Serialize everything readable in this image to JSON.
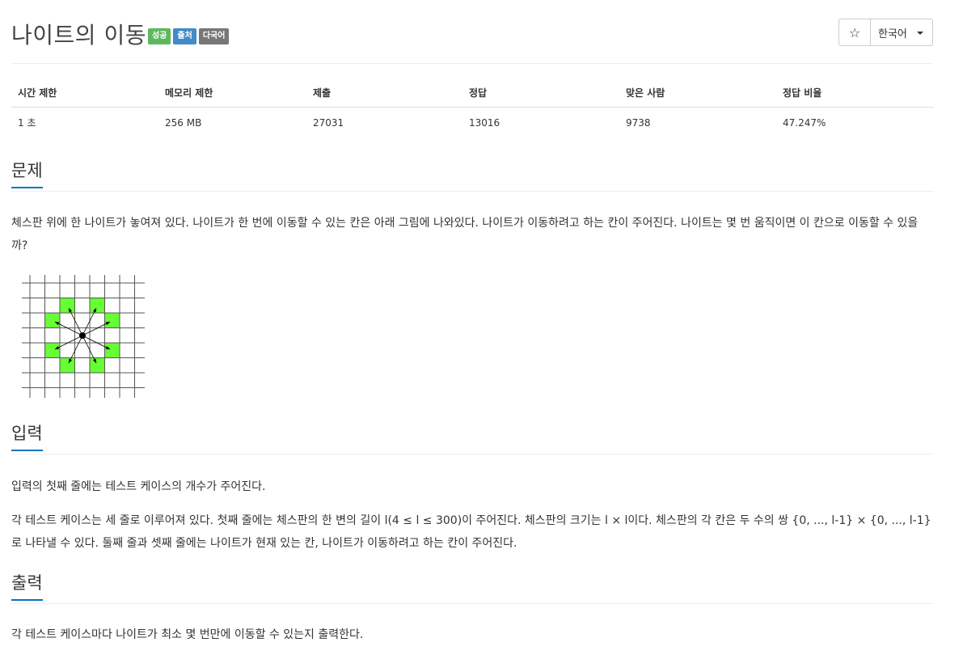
{
  "problem": {
    "title": "나이트의 이동",
    "labels": {
      "success": "성공",
      "source": "출처",
      "multilang": "다국어"
    }
  },
  "toolbar": {
    "star": "☆",
    "language": "한국어"
  },
  "info": {
    "headers": [
      "시간 제한",
      "메모리 제한",
      "제출",
      "정답",
      "맞은 사람",
      "정답 비율"
    ],
    "values": [
      "1 초",
      "256 MB",
      "27031",
      "13016",
      "9738",
      "47.247%"
    ]
  },
  "sections": {
    "description_title": "문제",
    "description": "체스판 위에 한 나이트가 놓여져 있다. 나이트가 한 번에 이동할 수 있는 칸은 아래 그림에 나와있다. 나이트가 이동하려고 하는 칸이 주어진다. 나이트는 몇 번 움직이면 이 칸으로 이동할 수 있을까?",
    "input_title": "입력",
    "input_1": "입력의 첫째 줄에는 테스트 케이스의 개수가 주어진다.",
    "input_2": "각 테스트 케이스는 세 줄로 이루어져 있다. 첫째 줄에는 체스판의 한 변의 길이 l(4 ≤ l ≤ 300)이 주어진다. 체스판의 크기는 l × l이다. 체스판의 각 칸은 두 수의 쌍 {0, ..., l-1} × {0, ..., l-1}로 나타낼 수 있다. 둘째 줄과 셋째 줄에는 나이트가 현재 있는 칸, 나이트가 이동하려고 하는 칸이 주어진다.",
    "output_title": "출력",
    "output": "각 테스트 케이스마다 나이트가 최소 몇 번만에 이동할 수 있는지 출력한다."
  },
  "figure": {
    "highlight_color": "#66ff33",
    "grid_color": "#555555"
  }
}
